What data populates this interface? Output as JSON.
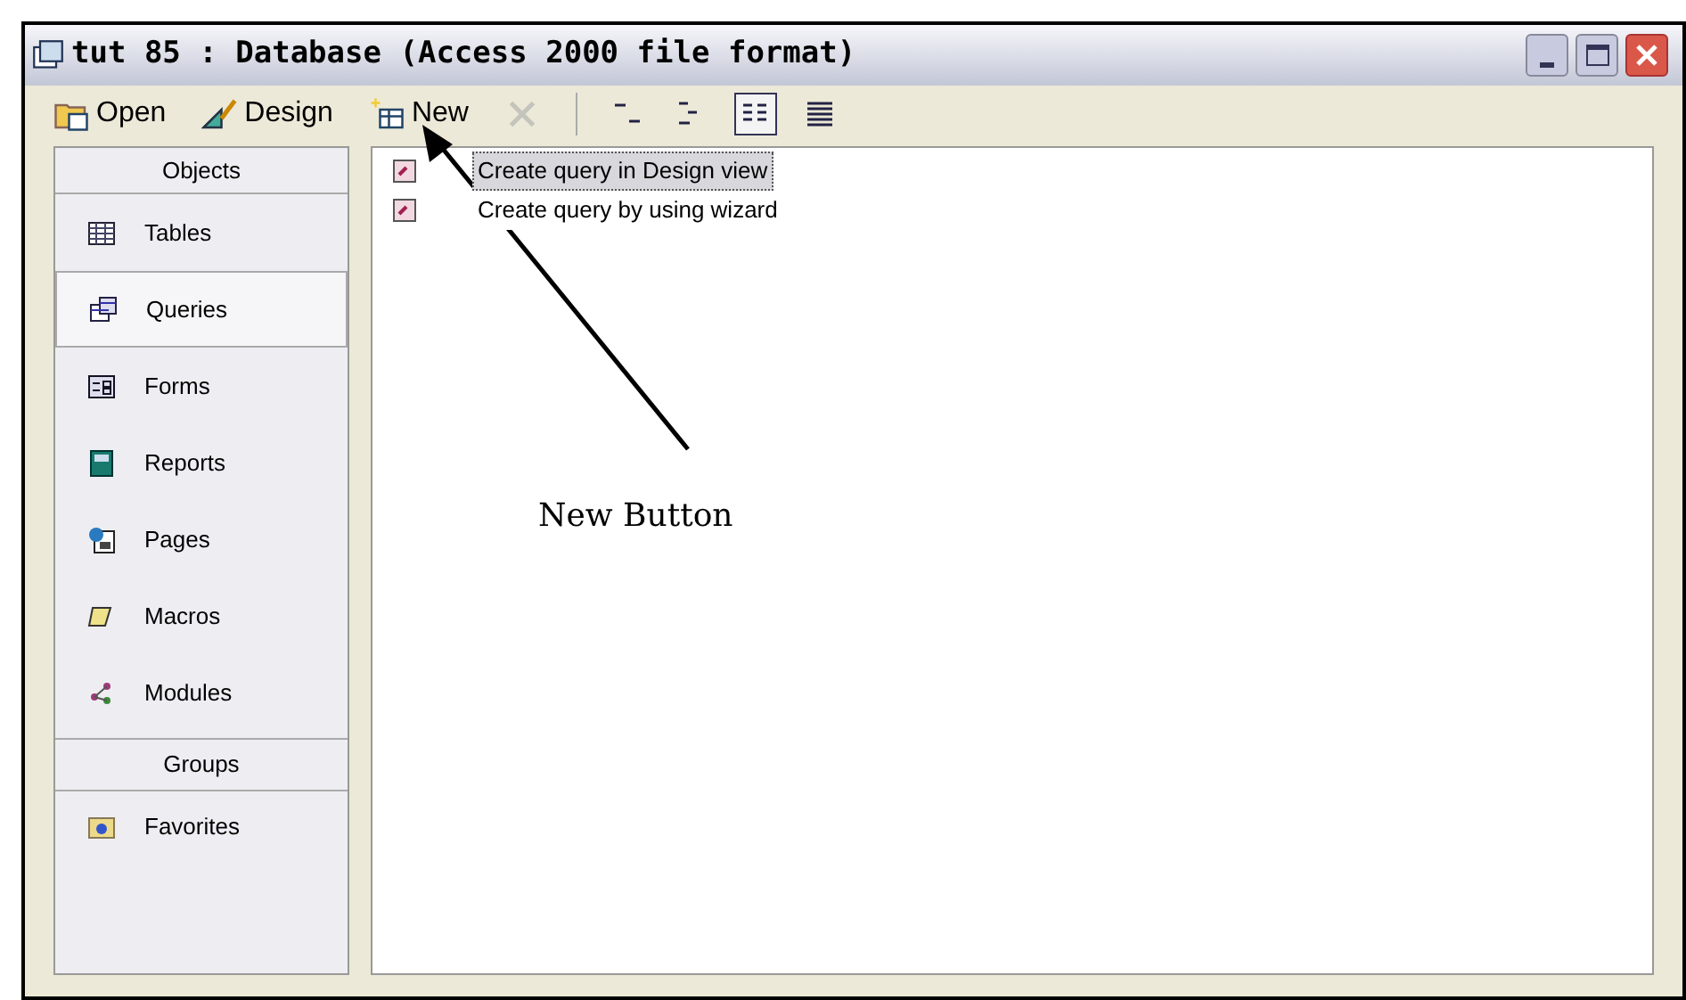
{
  "window": {
    "title": "tut 85 : Database (Access 2000 file format)"
  },
  "toolbar": [
    {
      "label": "Open",
      "disabled": false
    },
    {
      "label": "Design",
      "disabled": false
    },
    {
      "label": "New",
      "disabled": false
    },
    {
      "disabled": true
    }
  ],
  "view_buttons": [
    {
      "selected": false
    },
    {
      "selected": false
    },
    {
      "selected": true
    },
    {
      "selected": false
    }
  ],
  "sidebar": {
    "header": "Objects",
    "items": [
      {
        "label": "Tables",
        "selected": false
      },
      {
        "label": "Queries",
        "selected": true
      },
      {
        "label": "Forms",
        "selected": false
      },
      {
        "label": "Reports",
        "selected": false
      },
      {
        "label": "Pages",
        "selected": false
      },
      {
        "label": "Macros",
        "selected": false
      },
      {
        "label": "Modules",
        "selected": false
      }
    ],
    "groups_header": "Groups",
    "groups": [
      {
        "label": "Favorites",
        "selected": false
      }
    ]
  },
  "list": [
    {
      "label": "Create query in Design view",
      "selected": true
    },
    {
      "label": "Create query by using wizard",
      "selected": false
    }
  ],
  "annotation": {
    "text": "New Button"
  }
}
